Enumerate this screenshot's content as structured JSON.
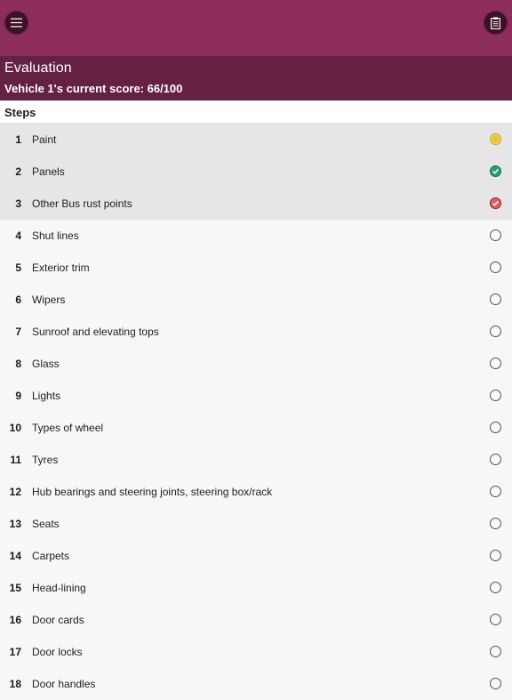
{
  "icons": {
    "menu": "hamburger-menu-icon",
    "clipboard": "clipboard-icon"
  },
  "colors": {
    "topbar": "#8c2d5c",
    "header": "#642141",
    "amber": "#e8c232",
    "green": "#2aa174",
    "red": "#e06068"
  },
  "header": {
    "title": "Evaluation",
    "score": "Vehicle 1's current score: 66/100"
  },
  "steps_label": "Steps",
  "steps": [
    {
      "num": "1",
      "label": "Paint",
      "status": "amber"
    },
    {
      "num": "2",
      "label": "Panels",
      "status": "green"
    },
    {
      "num": "3",
      "label": "Other Bus rust points",
      "status": "red"
    },
    {
      "num": "4",
      "label": "Shut lines",
      "status": "none"
    },
    {
      "num": "5",
      "label": "Exterior trim",
      "status": "none"
    },
    {
      "num": "6",
      "label": "Wipers",
      "status": "none"
    },
    {
      "num": "7",
      "label": "Sunroof and elevating tops",
      "status": "none"
    },
    {
      "num": "8",
      "label": "Glass",
      "status": "none"
    },
    {
      "num": "9",
      "label": "Lights",
      "status": "none"
    },
    {
      "num": "10",
      "label": "Types of wheel",
      "status": "none"
    },
    {
      "num": "11",
      "label": "Tyres",
      "status": "none"
    },
    {
      "num": "12",
      "label": "Hub bearings and steering joints, steering box/rack",
      "status": "none"
    },
    {
      "num": "13",
      "label": "Seats",
      "status": "none"
    },
    {
      "num": "14",
      "label": "Carpets",
      "status": "none"
    },
    {
      "num": "15",
      "label": "Head-lining",
      "status": "none"
    },
    {
      "num": "16",
      "label": "Door cards",
      "status": "none"
    },
    {
      "num": "17",
      "label": "Door locks",
      "status": "none"
    },
    {
      "num": "18",
      "label": "Door handles",
      "status": "none"
    }
  ]
}
